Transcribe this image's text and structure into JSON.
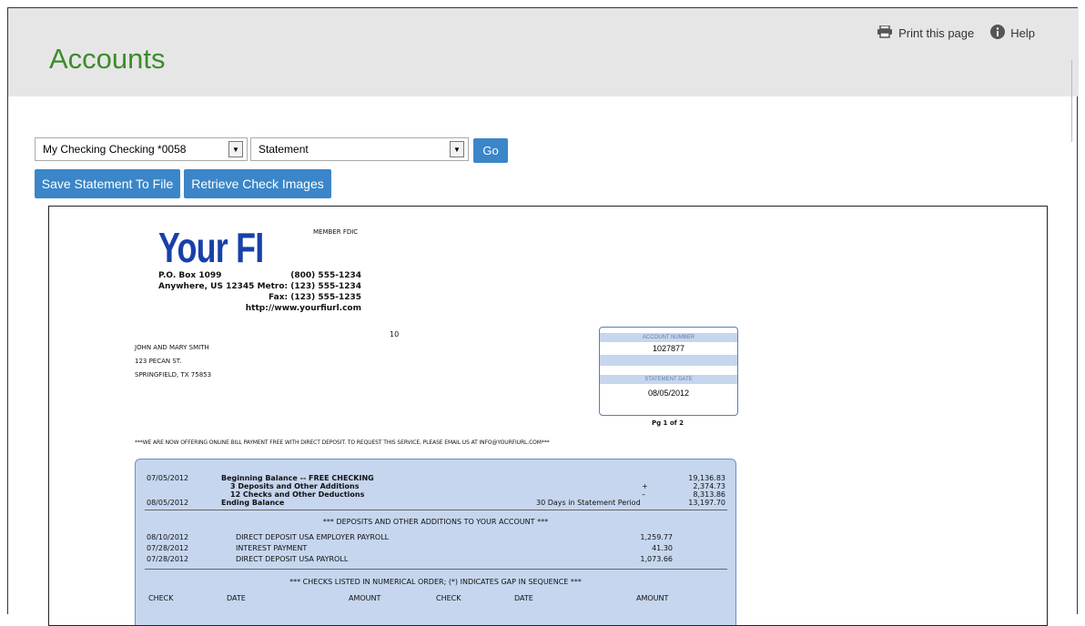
{
  "page": {
    "title": "Accounts"
  },
  "toplinks": {
    "print_label": "Print this page",
    "help_label": "Help"
  },
  "controls": {
    "account_select": "My Checking Checking *0058",
    "type_select": "Statement",
    "go_label": "Go",
    "save_label": "Save Statement To File",
    "retrieve_label": "Retrieve Check Images"
  },
  "statement": {
    "logo": "Your FI",
    "member": "MEMBER FDIC",
    "address": [
      "P.O. Box 1099",
      "Anywhere, US 12345"
    ],
    "phones": [
      "(800) 555-1234",
      "Metro: (123) 555-1234",
      "Fax: (123) 555-1235",
      "http://www.yourfiurl.com"
    ],
    "ten": "10",
    "customer": [
      "JOHN AND MARY SMITH",
      "123 PECAN ST.",
      "SPRINGFIELD, TX 75853"
    ],
    "account_number_label": "ACCOUNT NUMBER",
    "account_number": "1027877",
    "statement_date_label": "STATEMENT DATE",
    "statement_date": "08/05/2012",
    "page": "Pg 1 of 2",
    "notice": "***WE ARE NOW OFFERING ONLINE BILL PAYMENT FREE WITH DIRECT DEPOSIT. TO REQUEST THIS SERVICE, PLEASE EMAIL US AT INFO@YOURFIURL.COM***",
    "summary": [
      {
        "date": "07/05/2012",
        "desc": "Beginning Balance -- FREE CHECKING",
        "sign": "",
        "amount": "19,136.83"
      },
      {
        "date": "",
        "desc": "3 Deposits and Other Additions",
        "sign": "+",
        "amount": "2,374.73"
      },
      {
        "date": "",
        "desc": "12 Checks and Other Deductions",
        "sign": "–",
        "amount": "8,313.86"
      },
      {
        "date": "08/05/2012",
        "desc": "Ending Balance",
        "sign": "30 Days in Statement Period",
        "amount": "13,197.70"
      }
    ],
    "deposits_header": "*** DEPOSITS AND OTHER ADDITIONS TO YOUR ACCOUNT ***",
    "deposits": [
      {
        "date": "08/10/2012",
        "desc": "DIRECT DEPOSIT USA EMPLOYER PAYROLL",
        "amount": "1,259.77"
      },
      {
        "date": "07/28/2012",
        "desc": "INTEREST PAYMENT",
        "amount": "41.30"
      },
      {
        "date": "07/28/2012",
        "desc": "DIRECT DEPOSIT USA PAYROLL",
        "amount": "1,073.66"
      }
    ],
    "checks_header": "*** CHECKS LISTED IN NUMERICAL ORDER; (*) INDICATES GAP IN SEQUENCE ***",
    "checks_columns": [
      "CHECK",
      "DATE",
      "AMOUNT",
      "CHECK",
      "DATE",
      "AMOUNT"
    ]
  }
}
